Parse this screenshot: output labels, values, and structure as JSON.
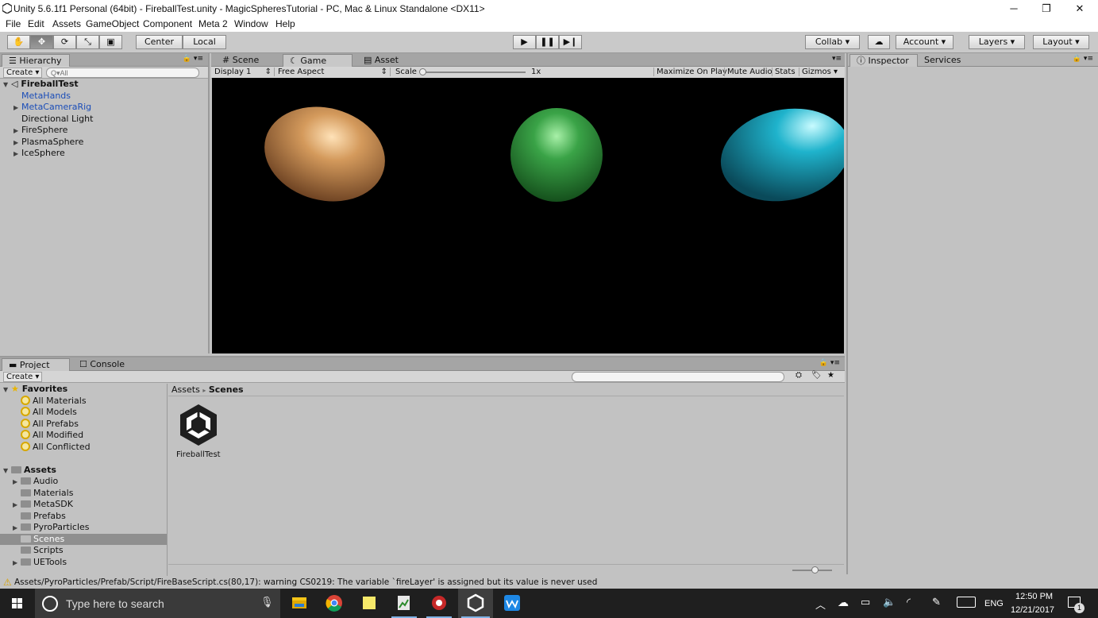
{
  "window": {
    "title": "Unity 5.6.1f1 Personal (64bit) - FireballTest.unity - MagicSpheresTutorial - PC, Mac & Linux Standalone <DX11>",
    "minimize": "─",
    "restore": "❐",
    "close": "✕"
  },
  "menu": [
    "File",
    "Edit",
    "Assets",
    "GameObject",
    "Component",
    "Meta 2",
    "Window",
    "Help"
  ],
  "toolbar": {
    "pivot": "Center",
    "space": "Local",
    "collab": "Collab",
    "account": "Account",
    "layers": "Layers",
    "layout": "Layout"
  },
  "hierarchy": {
    "tab": "Hierarchy",
    "create": "Create",
    "search_placeholder": "Q▾All",
    "scene": "FireballTest",
    "items": [
      "MetaHands",
      "MetaCameraRig",
      "Directional Light",
      "FireSphere",
      "PlasmaSphere",
      "IceSphere"
    ]
  },
  "center": {
    "tabs": [
      "Scene",
      "Game",
      "Asset Store"
    ],
    "display": "Display 1",
    "aspect": "Free Aspect",
    "scale_label": "Scale",
    "scale_value": "1x",
    "maximize": "Maximize On Play",
    "mute": "Mute Audio",
    "stats": "Stats",
    "gizmos": "Gizmos"
  },
  "inspector": {
    "tabs": [
      "Inspector",
      "Services"
    ]
  },
  "project": {
    "tabs": [
      "Project",
      "Console"
    ],
    "create": "Create",
    "favorites_label": "Favorites",
    "favorites": [
      "All Materials",
      "All Models",
      "All Prefabs",
      "All Modified",
      "All Conflicted"
    ],
    "assets_label": "Assets",
    "folders": [
      "Audio",
      "Materials",
      "MetaSDK",
      "Prefabs",
      "PyroParticles",
      "Scenes",
      "Scripts",
      "UETools"
    ],
    "breadcrumb_root": "Assets",
    "breadcrumb_sep": "▸",
    "breadcrumb_current": "Scenes",
    "asset_name": "FireballTest"
  },
  "status": {
    "message": "Assets/PyroParticles/Prefab/Script/FireBaseScript.cs(80,17): warning CS0219: The variable `fireLayer' is assigned but its value is never used"
  },
  "taskbar": {
    "search_placeholder": "Type here to search",
    "lang": "ENG",
    "time": "12:50 PM",
    "date": "12/21/2017",
    "notif_count": "1"
  },
  "colors": {
    "fire_sphere": "#d49a5c",
    "plasma_sphere": "#3aa347",
    "ice_sphere": "#1fb3cc"
  }
}
